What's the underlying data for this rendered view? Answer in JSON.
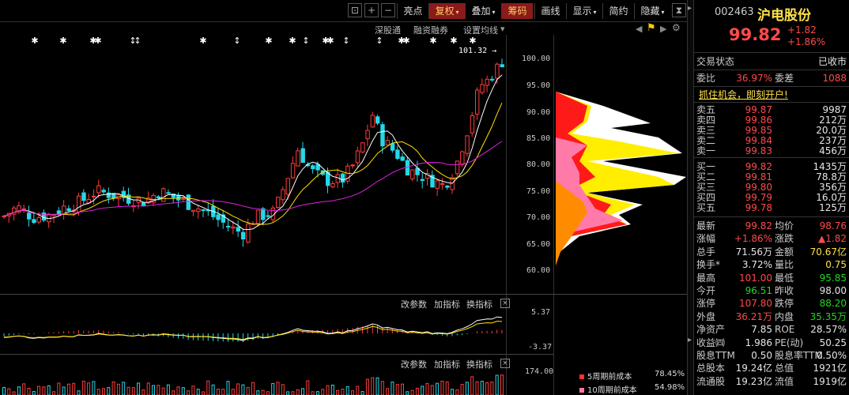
{
  "toolbar": {
    "buttons": [
      {
        "label": "亮点",
        "dropdown": false,
        "active": false
      },
      {
        "label": "复权",
        "dropdown": true,
        "active": true
      },
      {
        "label": "叠加",
        "dropdown": true,
        "active": false
      },
      {
        "label": "筹码",
        "dropdown": false,
        "active": true
      },
      {
        "label": "画线",
        "dropdown": false,
        "active": false
      },
      {
        "label": "显示",
        "dropdown": true,
        "active": false
      },
      {
        "label": "简约",
        "dropdown": false,
        "active": false
      },
      {
        "label": "隐藏",
        "dropdown": true,
        "active": false
      }
    ],
    "icons": [
      "lock-icon",
      "zoom-in-icon",
      "zoom-out-icon",
      "collapse-icon"
    ]
  },
  "subtoolbar": {
    "items": [
      "深股通",
      "融资融券",
      "设置均线"
    ],
    "dropdown_mark": "▾"
  },
  "main_chart": {
    "max_label": "101.32",
    "y_ticks": [
      "100.00",
      "95.00",
      "90.00",
      "85.00",
      "80.00",
      "75.00",
      "70.00",
      "65.00",
      "60.00"
    ]
  },
  "indicator1": {
    "buttons": [
      "改参数",
      "加指标",
      "换指标"
    ],
    "close": "×",
    "y_top": "5.37",
    "y_bottom": "-3.37"
  },
  "indicator2": {
    "buttons": [
      "改参数",
      "加指标",
      "换指标"
    ],
    "close": "×",
    "y_top": "174.00"
  },
  "chip_legend": [
    {
      "label": "5周期前成本",
      "value": "78.45%",
      "color": "#ff3030"
    },
    {
      "label": "10周期前成本",
      "value": "54.98%",
      "color": "#ff7aa8"
    }
  ],
  "quote": {
    "code": "002463",
    "name": "沪电股份",
    "price": "99.82",
    "change": "+1.82",
    "change_pct": "+1.86%",
    "status_label": "交易状态",
    "status_value": "已收市",
    "weibi_label": "委比",
    "weibi_value": "36.97%",
    "weicha_label": "委差",
    "weicha_value": "1088",
    "promo": "抓住机会，即刻开户!",
    "asks": [
      {
        "label": "卖五",
        "price": "99.87",
        "vol": "9987"
      },
      {
        "label": "卖四",
        "price": "99.86",
        "vol": "212万"
      },
      {
        "label": "卖三",
        "price": "99.85",
        "vol": "20.0万"
      },
      {
        "label": "卖二",
        "price": "99.84",
        "vol": "237万"
      },
      {
        "label": "卖一",
        "price": "99.83",
        "vol": "456万"
      }
    ],
    "bids": [
      {
        "label": "买一",
        "price": "99.82",
        "vol": "1435万"
      },
      {
        "label": "买二",
        "price": "99.81",
        "vol": "78.8万"
      },
      {
        "label": "买三",
        "price": "99.80",
        "vol": "356万"
      },
      {
        "label": "买四",
        "price": "99.79",
        "vol": "16.0万"
      },
      {
        "label": "买五",
        "price": "99.78",
        "vol": "125万"
      }
    ],
    "stats": [
      {
        "l1": "最新",
        "v1": "99.82",
        "c1": "r",
        "l2": "均价",
        "v2": "98.76",
        "c2": "r"
      },
      {
        "l1": "涨幅",
        "v1": "+1.86%",
        "c1": "r",
        "l2": "涨跌",
        "v2": "▲1.82",
        "c2": "r"
      },
      {
        "l1": "总手",
        "v1": "71.56万",
        "c1": "w",
        "l2": "金额",
        "v2": "70.67亿",
        "c2": "y"
      },
      {
        "l1": "换手*",
        "v1": "3.72%",
        "c1": "w",
        "l2": "量比",
        "v2": "0.75",
        "c2": "y"
      },
      {
        "l1": "最高",
        "v1": "101.00",
        "c1": "r",
        "l2": "最低",
        "v2": "95.85",
        "c2": "g"
      },
      {
        "l1": "今开",
        "v1": "96.51",
        "c1": "g",
        "l2": "昨收",
        "v2": "98.00",
        "c2": "w"
      },
      {
        "l1": "涨停",
        "v1": "107.80",
        "c1": "r",
        "l2": "跌停",
        "v2": "88.20",
        "c2": "g"
      },
      {
        "l1": "外盘",
        "v1": "36.21万",
        "c1": "r",
        "l2": "内盘",
        "v2": "35.35万",
        "c2": "g"
      },
      {
        "l1": "净资产",
        "v1": "7.85",
        "c1": "w",
        "l2": "ROE",
        "v2": "28.57%",
        "c2": "w"
      },
      {
        "l1": "收益㈣",
        "v1": "1.986",
        "c1": "w",
        "l2": "PE(动)",
        "v2": "50.25",
        "c2": "w"
      },
      {
        "l1": "股息TTM",
        "v1": "0.50",
        "c1": "w",
        "l2": "股息率TTM",
        "v2": "0.50%",
        "c2": "w"
      },
      {
        "l1": "总股本",
        "v1": "19.24亿",
        "c1": "w",
        "l2": "总值",
        "v2": "1921亿",
        "c2": "w"
      },
      {
        "l1": "流通股",
        "v1": "19.23亿",
        "c1": "w",
        "l2": "流值",
        "v2": "1919亿",
        "c2": "w"
      }
    ]
  },
  "colors": {
    "up": "#ff3b3b",
    "down": "#25d8e8",
    "ma_white": "#ffffff",
    "ma_yellow": "#ffe000",
    "ma_magenta": "#e020e0",
    "chip_yellow": "#ffee00",
    "chip_red": "#ff1a1a",
    "chip_pink": "#ff7aa8",
    "chip_orange": "#ff8c00"
  }
}
